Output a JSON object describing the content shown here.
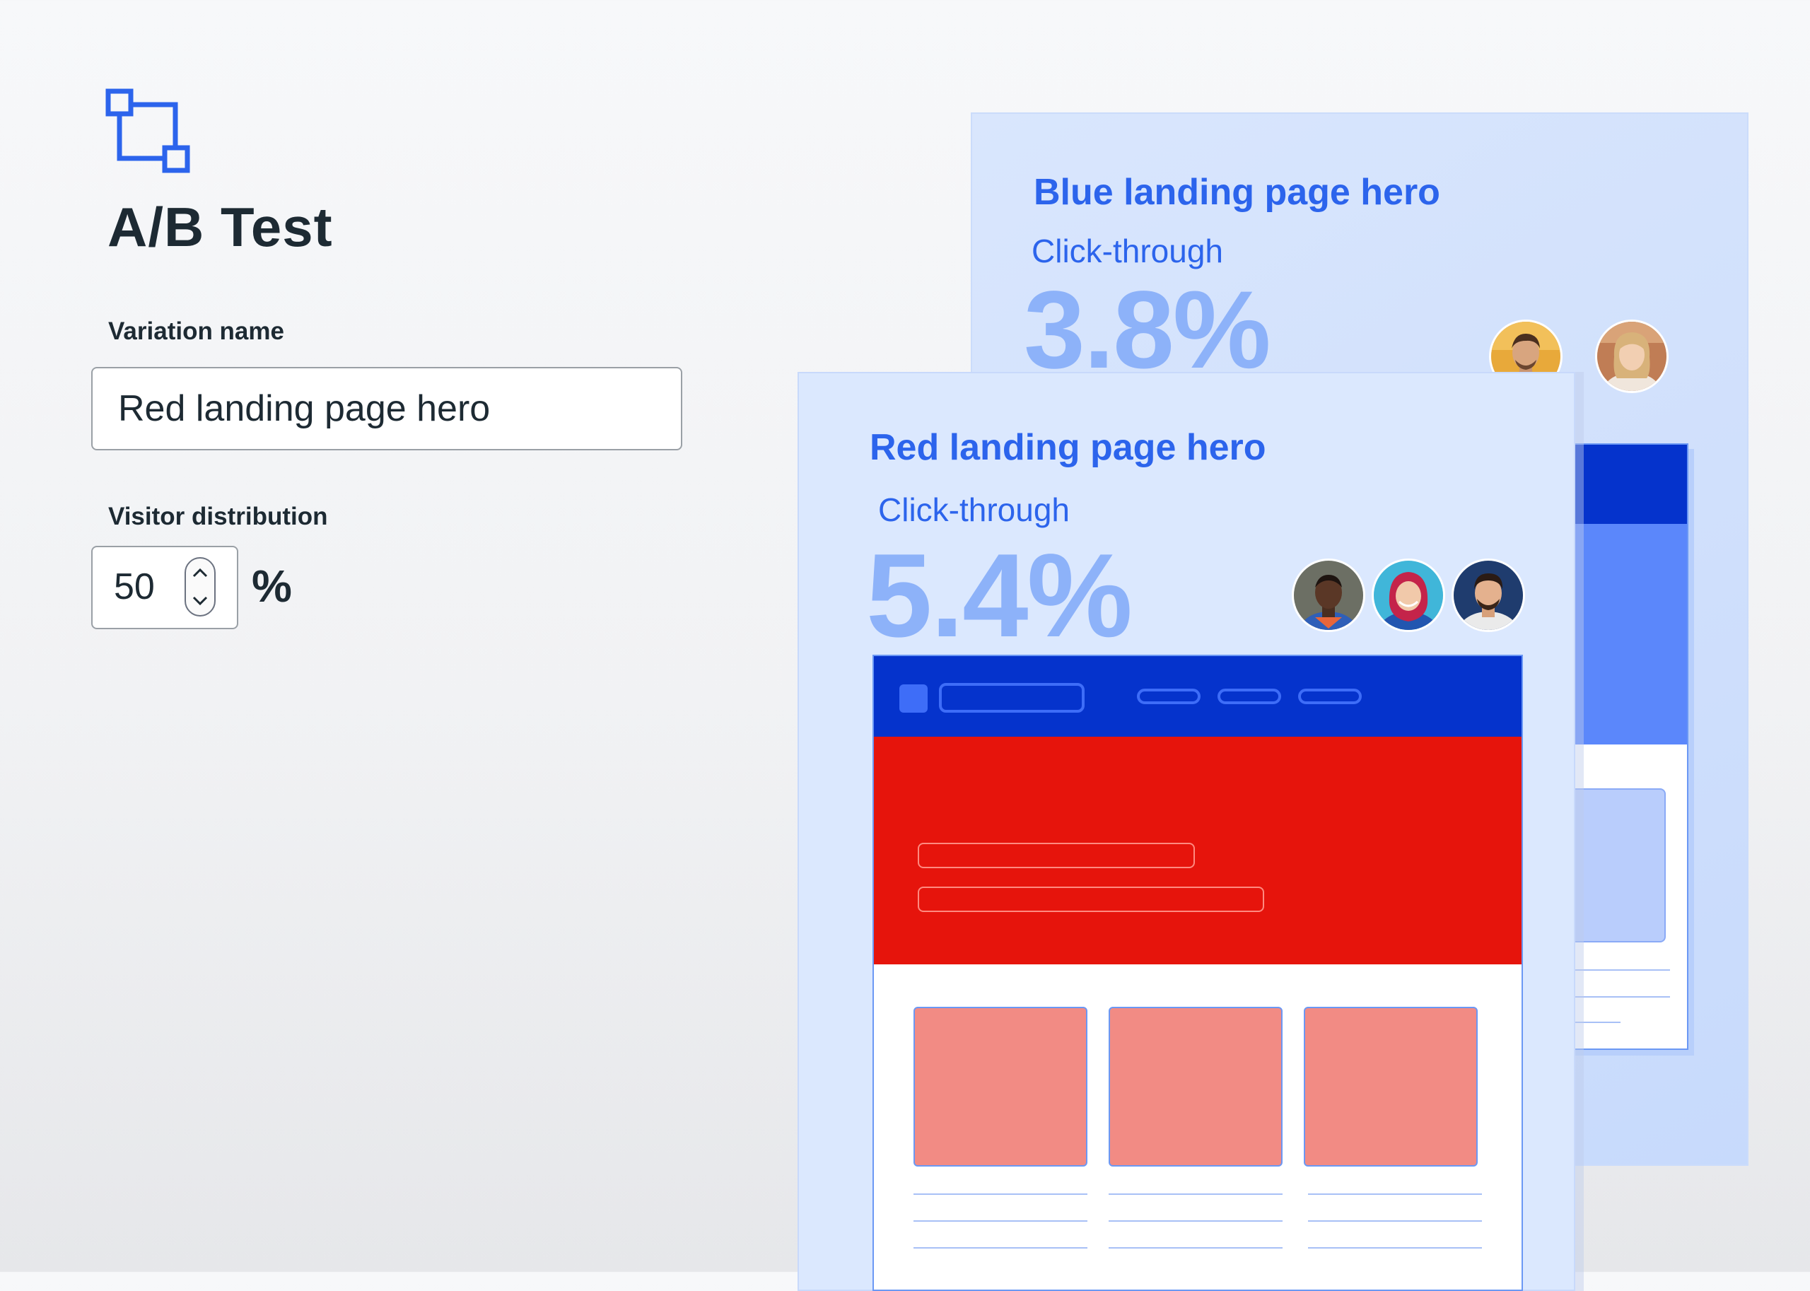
{
  "app": {
    "icon": "ab-test-icon",
    "title": "A/B Test"
  },
  "form": {
    "variation_name_label": "Variation name",
    "variation_name_value": "Red landing page hero",
    "visitor_distribution_label": "Visitor distribution",
    "visitor_distribution_value": "50",
    "visitor_distribution_unit": "%"
  },
  "variations": [
    {
      "name": "Blue landing page hero",
      "metric_label": "Click-through",
      "metric_value": "3.8%",
      "accent_color": "#0533cc",
      "hero_color": "#5b87fb"
    },
    {
      "name": "Red landing page hero",
      "metric_label": "Click-through",
      "metric_value": "5.4%",
      "accent_color": "#0533cc",
      "hero_color": "#e6140c"
    }
  ],
  "colors": {
    "brand_blue": "#2c64ec",
    "metric_light_blue": "#8db2f9",
    "card_bg": "#dbe8fe"
  }
}
